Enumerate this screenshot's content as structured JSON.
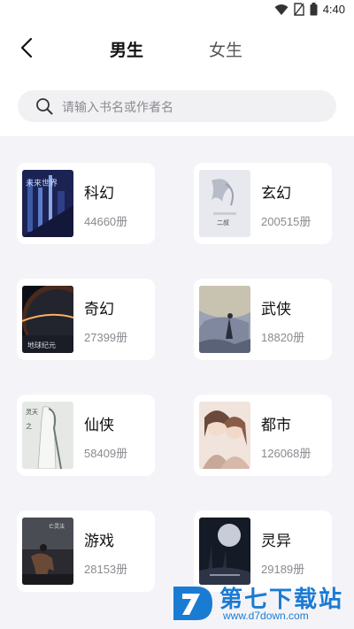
{
  "status_bar": {
    "time": "4:40"
  },
  "header": {
    "tabs": [
      {
        "label": "男生",
        "active": true
      },
      {
        "label": "女生",
        "active": false
      }
    ]
  },
  "search": {
    "placeholder": "请输入书名或作者名"
  },
  "categories": [
    {
      "title": "科幻",
      "count": "44660册",
      "cover": "scifi-cover"
    },
    {
      "title": "玄幻",
      "count": "200515册",
      "cover": "fantasy-cover"
    },
    {
      "title": "奇幻",
      "count": "27399册",
      "cover": "magic-cover"
    },
    {
      "title": "武侠",
      "count": "18820册",
      "cover": "wuxia-cover"
    },
    {
      "title": "仙侠",
      "count": "58409册",
      "cover": "xianxia-cover"
    },
    {
      "title": "都市",
      "count": "126068册",
      "cover": "urban-cover"
    },
    {
      "title": "游戏",
      "count": "28153册",
      "cover": "game-cover"
    },
    {
      "title": "灵异",
      "count": "29189册",
      "cover": "supernatural-cover"
    }
  ],
  "watermark": {
    "title": "第七下载站",
    "url": "www.d7down.com"
  },
  "colors": {
    "accent_underline": "#f7b08f",
    "watermark": "#1a7bd3"
  }
}
